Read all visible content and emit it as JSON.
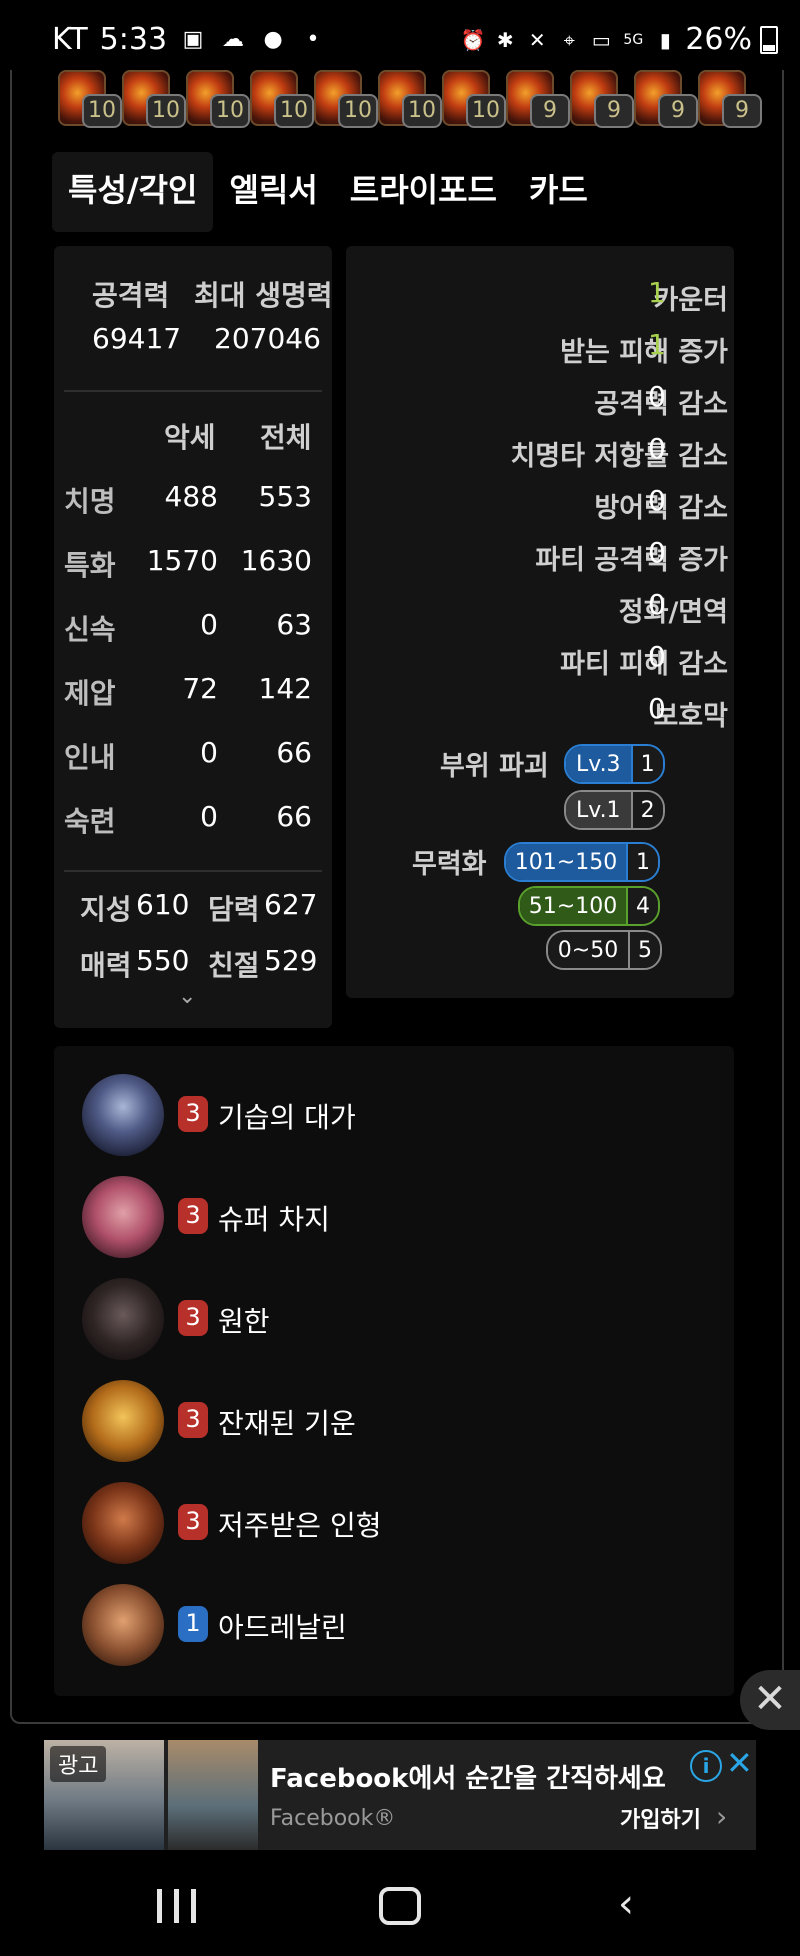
{
  "status_bar": {
    "carrier": "KT",
    "time": "5:33",
    "battery": "26%",
    "network": "5G"
  },
  "gems": {
    "levels": [
      "10",
      "10",
      "10",
      "10",
      "10",
      "10",
      "10",
      "9",
      "9",
      "9",
      "9"
    ]
  },
  "tabs": [
    "특성/각인",
    "엘릭서",
    "트라이포드",
    "카드"
  ],
  "left_panel": {
    "attack_label": "공격력",
    "hp_label": "최대 생명력",
    "attack_value": "69417",
    "hp_value": "207046",
    "col_acc": "악세",
    "col_total": "전체",
    "stats": [
      {
        "label": "치명",
        "acc": "488",
        "total": "553"
      },
      {
        "label": "특화",
        "acc": "1570",
        "total": "1630"
      },
      {
        "label": "신속",
        "acc": "0",
        "total": "63"
      },
      {
        "label": "제압",
        "acc": "72",
        "total": "142"
      },
      {
        "label": "인내",
        "acc": "0",
        "total": "66"
      },
      {
        "label": "숙련",
        "acc": "0",
        "total": "66"
      }
    ],
    "traits": [
      {
        "label": "지성",
        "value": "610"
      },
      {
        "label": "담력",
        "value": "627"
      },
      {
        "label": "매력",
        "value": "550"
      },
      {
        "label": "친절",
        "value": "529"
      }
    ]
  },
  "right_panel": {
    "rows": [
      {
        "label": "카운터",
        "value": "1",
        "highlight": true
      },
      {
        "label": "받는 피해 증가",
        "value": "1",
        "highlight": true
      },
      {
        "label": "공격력 감소",
        "value": "0",
        "highlight": false
      },
      {
        "label": "치명타 저항률 감소",
        "value": "0",
        "highlight": false
      },
      {
        "label": "방어력 감소",
        "value": "0",
        "highlight": false
      },
      {
        "label": "파티 공격력 증가",
        "value": "0",
        "highlight": false
      },
      {
        "label": "정화/면역",
        "value": "0",
        "highlight": false
      },
      {
        "label": "파티 피해 감소",
        "value": "0",
        "highlight": false
      },
      {
        "label": "보호막",
        "value": "0",
        "highlight": false
      }
    ],
    "part_break_label": "부위 파괴",
    "part_break": [
      {
        "tag": "Lv.3",
        "count": "1",
        "color": "#2a7fd4"
      },
      {
        "tag": "Lv.1",
        "count": "2",
        "color": "#8a8a8a"
      }
    ],
    "stagger_label": "무력화",
    "stagger": [
      {
        "tag": "101~150",
        "count": "1",
        "color": "#2a7fd4"
      },
      {
        "tag": "51~100",
        "count": "4",
        "color": "#5aa02c"
      },
      {
        "tag": "0~50",
        "count": "5",
        "color": "#8a8a8a"
      }
    ]
  },
  "engravings": [
    {
      "level": "3",
      "name": "기습의 대가",
      "badge_color": "#b8302a",
      "icon": "ambush-icon"
    },
    {
      "level": "3",
      "name": "슈퍼 차지",
      "badge_color": "#b8302a",
      "icon": "super-charge-icon"
    },
    {
      "level": "3",
      "name": "원한",
      "badge_color": "#b8302a",
      "icon": "grudge-icon"
    },
    {
      "level": "3",
      "name": "잔재된 기운",
      "badge_color": "#b8302a",
      "icon": "remnant-energy-icon"
    },
    {
      "level": "3",
      "name": "저주받은 인형",
      "badge_color": "#b8302a",
      "icon": "cursed-doll-icon"
    },
    {
      "level": "1",
      "name": "아드레날린",
      "badge_color": "#2a6fc4",
      "icon": "adrenaline-icon"
    }
  ],
  "ad": {
    "tag": "광고",
    "title": "Facebook에서 순간을 간직하세요",
    "sponsor": "Facebook®",
    "cta": "가입하기"
  }
}
